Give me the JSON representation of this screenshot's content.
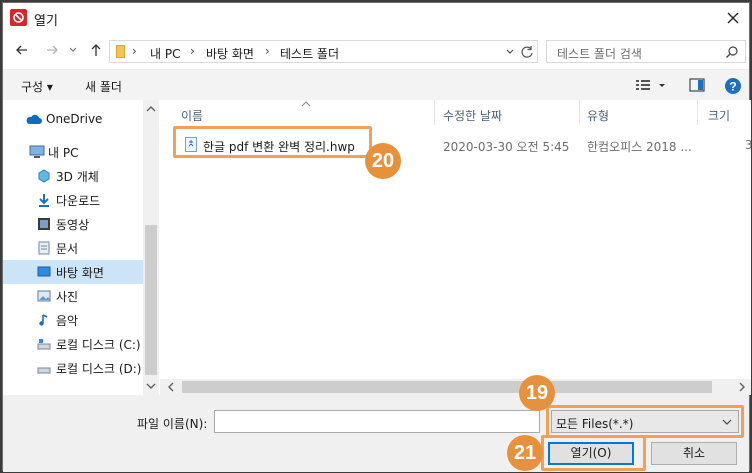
{
  "window": {
    "title": "열기"
  },
  "address": {
    "crumbs": [
      "내 PC",
      "바탕 화면",
      "테스트 폴더"
    ],
    "search_placeholder": "테스트 폴더 검색"
  },
  "toolbar": {
    "organize": "구성 ▾",
    "new_folder": "새 폴더"
  },
  "nav": {
    "items": [
      {
        "label": "OneDrive",
        "icon": "cloud-icon"
      },
      {
        "label": "내 PC",
        "icon": "computer-icon"
      },
      {
        "label": "3D 개체",
        "icon": "cube-icon"
      },
      {
        "label": "다운로드",
        "icon": "download-icon"
      },
      {
        "label": "동영상",
        "icon": "video-icon"
      },
      {
        "label": "문서",
        "icon": "document-icon"
      },
      {
        "label": "바탕 화면",
        "icon": "desktop-icon",
        "selected": true
      },
      {
        "label": "사진",
        "icon": "picture-icon"
      },
      {
        "label": "음악",
        "icon": "music-icon"
      },
      {
        "label": "로컬 디스크 (C:)",
        "icon": "drive-icon"
      },
      {
        "label": "로컬 디스크 (D:)",
        "icon": "drive-icon"
      }
    ]
  },
  "columns": {
    "name": "이름",
    "date": "수정한 날짜",
    "type": "유형",
    "size": "크기"
  },
  "files": [
    {
      "name": "한글 pdf 변환 완벽 정리.hwp",
      "date": "2020-03-30 오전 5:45",
      "type": "한컴오피스 2018 ...",
      "size": "3"
    }
  ],
  "bottom": {
    "filename_label": "파일 이름(N):",
    "filename_value": "",
    "filter": "모든 Files(*.*)",
    "open_button": "열기(O)",
    "cancel_button": "취소"
  },
  "annotations": {
    "step_filter": "19",
    "step_file": "20",
    "step_open": "21"
  },
  "colors": {
    "accent": "#0078d7",
    "highlight": "#f0a057",
    "badge": "#e8913d",
    "selected": "#cce4f7"
  }
}
